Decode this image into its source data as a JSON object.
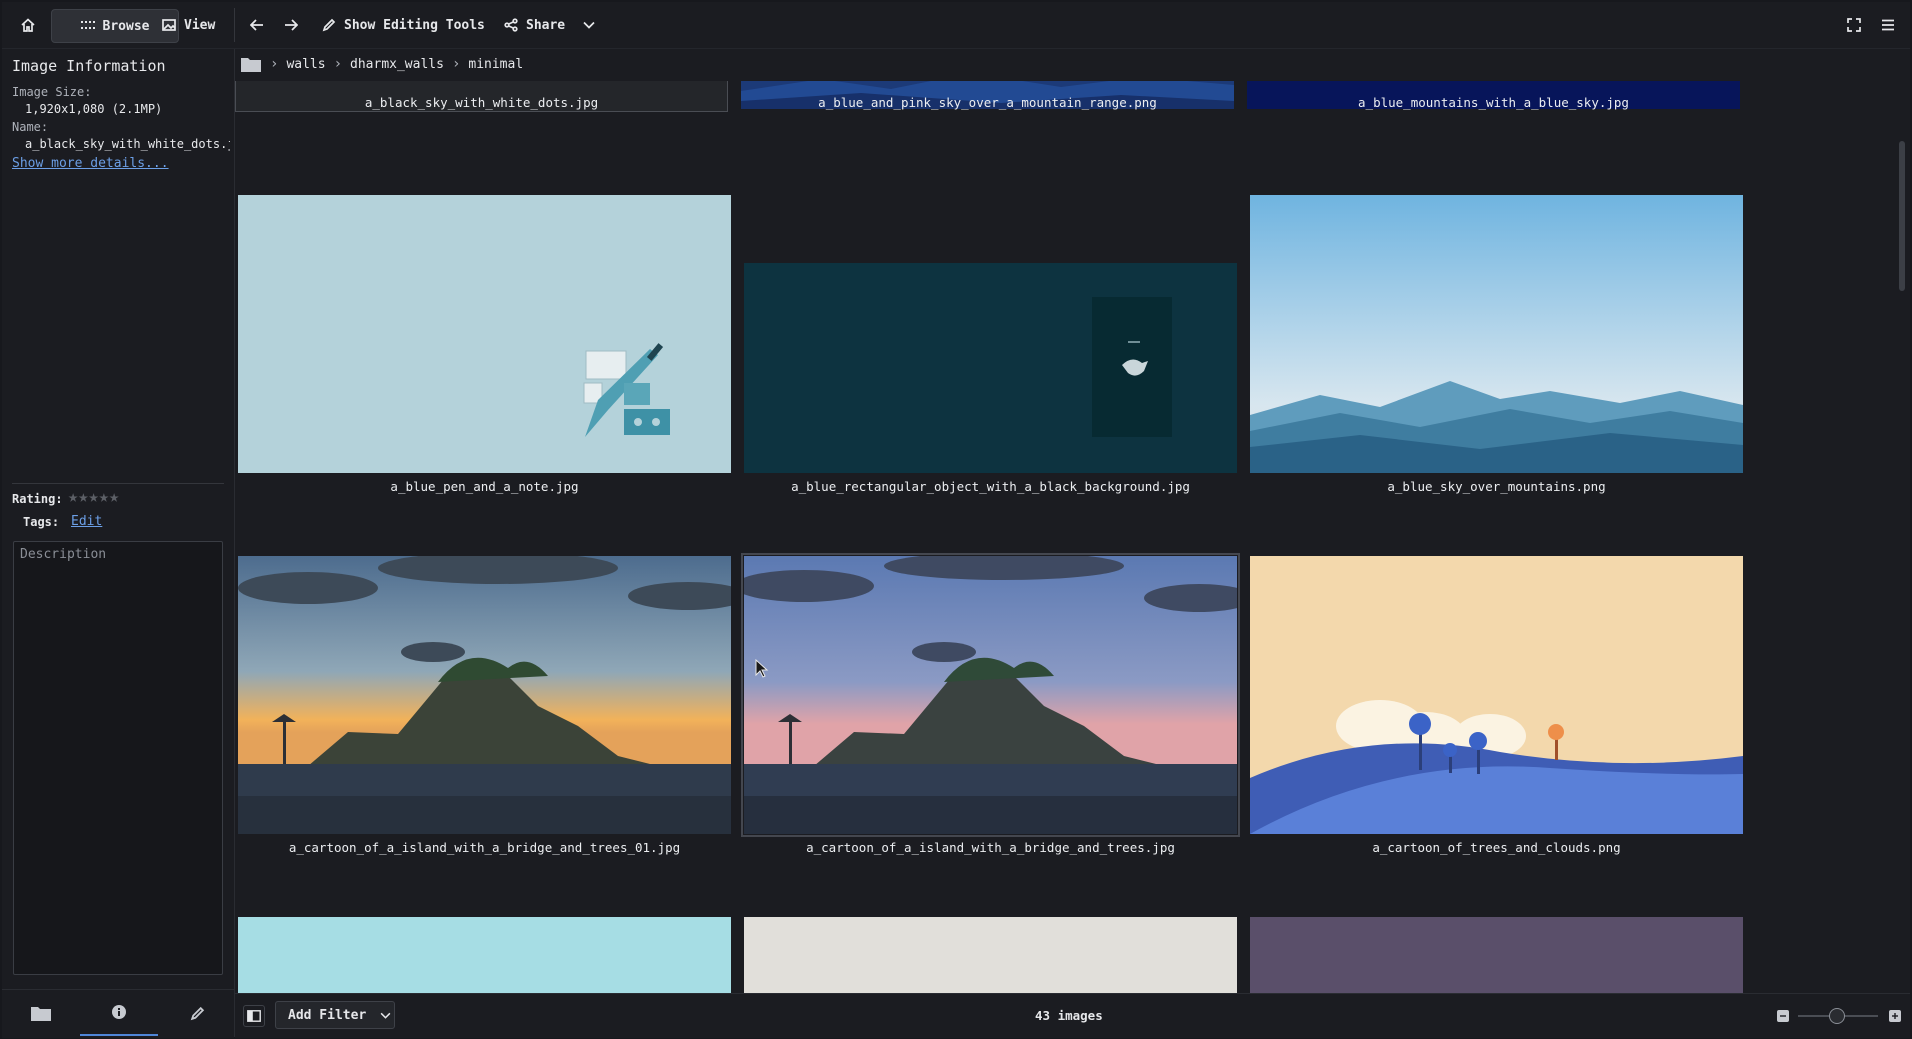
{
  "toolbar": {
    "browse_label": "Browse",
    "view_label": "View",
    "editing_label": "Show Editing Tools",
    "share_label": "Share"
  },
  "sidebar": {
    "title": "Image Information",
    "size_label": "Image Size:",
    "size_value": "1,920x1,080 (2.1MP)",
    "name_label": "Name:",
    "name_value": "a_black_sky_with_white_dots.jpg",
    "more_details": "Show more details...",
    "rating_label": "Rating:",
    "rating_value": 0,
    "rating_max": 5,
    "tags_label": "Tags:",
    "tags_edit": "Edit",
    "description_placeholder": "Description"
  },
  "breadcrumb": [
    "walls",
    "dharmx_walls",
    "minimal"
  ],
  "grid": {
    "captions": [
      "a_black_sky_with_white_dots.jpg",
      "a_blue_and_pink_sky_over_a_mountain_range.png",
      "a_blue_mountains_with_a_blue_sky.jpg",
      "a_blue_pen_and_a_note.jpg",
      "a_blue_rectangular_object_with_a_black_background.jpg",
      "a_blue_sky_over_mountains.png",
      "a_cartoon_of_a_island_with_a_bridge_and_trees_01.jpg",
      "a_cartoon_of_a_island_with_a_bridge_and_trees.jpg",
      "a_cartoon_of_trees_and_clouds.png"
    ]
  },
  "bottom": {
    "filter_label": "Add Filter",
    "count_label": "43 images"
  },
  "colors": {
    "accent": "#4f86d8",
    "link": "#6c9fe6",
    "background": "#1b1c21"
  }
}
